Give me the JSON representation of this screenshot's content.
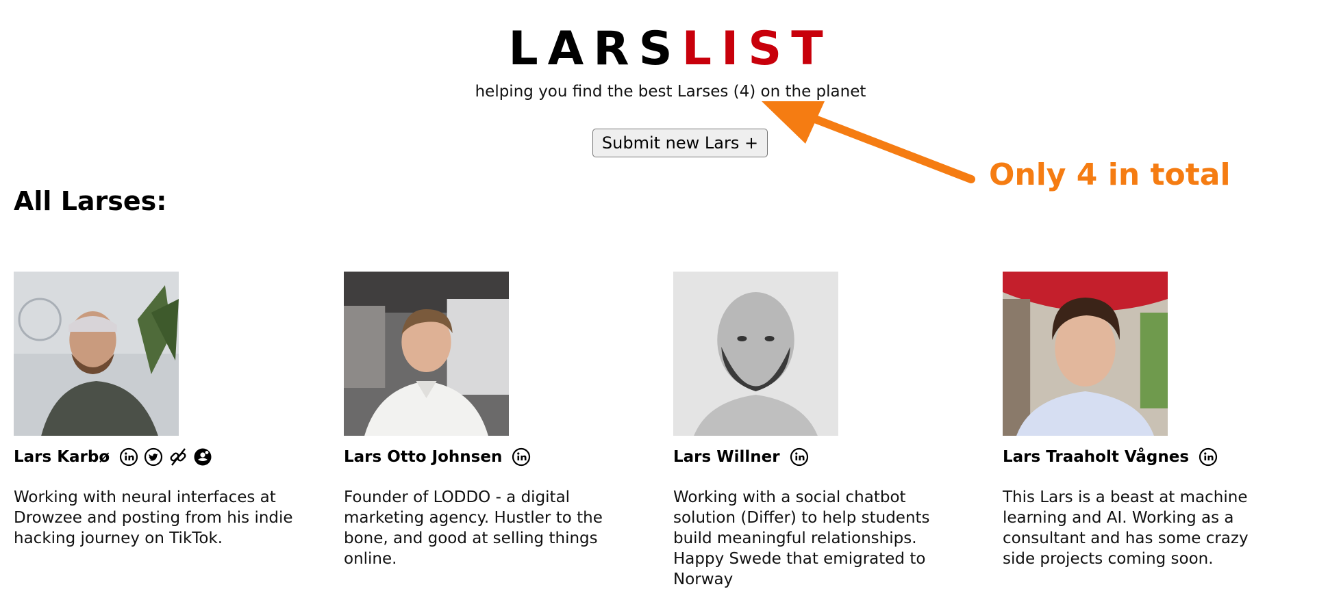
{
  "header": {
    "logo_part1": "LARS",
    "logo_part2": "LIST",
    "tagline": "helping you find the best Larses (4) on the planet",
    "submit_label": "Submit new Lars +"
  },
  "section_title": "All Larses:",
  "annotation": {
    "text": "Only 4 in total",
    "color": "#f57c12"
  },
  "colors": {
    "brand_red": "#c8000b",
    "annotation_orange": "#f57c12"
  },
  "cards": [
    {
      "name": "Lars Karbø",
      "icons": [
        "linkedin-icon",
        "twitter-icon",
        "link-icon",
        "producthunt-icon"
      ],
      "description": "Working with neural interfaces at Drowzee and posting from his indie hacking journey on TikTok."
    },
    {
      "name": "Lars Otto Johnsen",
      "icons": [
        "linkedin-icon"
      ],
      "description": "Founder of LODDO - a digital marketing agency. Hustler to the bone, and good at selling things online."
    },
    {
      "name": "Lars Willner",
      "icons": [
        "linkedin-icon"
      ],
      "description": "Working with a social chatbot solution (Differ) to help students build meaningful relationships. Happy Swede that emigrated to Norway"
    },
    {
      "name": "Lars Traaholt Vågnes",
      "icons": [
        "linkedin-icon"
      ],
      "description": "This Lars is a beast at machine learning and AI. Working as a consultant and has some crazy side projects coming soon."
    }
  ]
}
